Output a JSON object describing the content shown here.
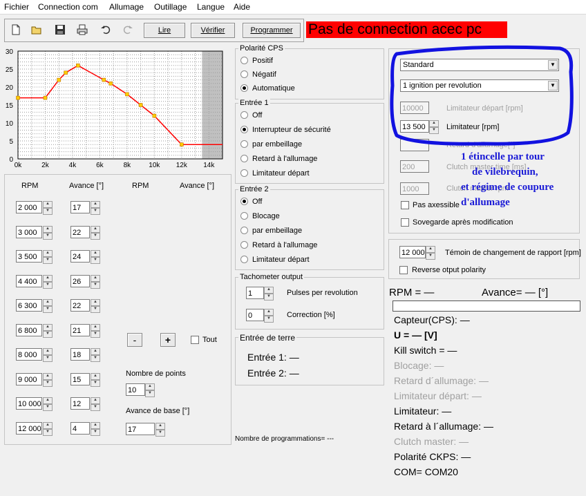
{
  "menu": [
    "Fichier",
    "Connection com",
    "Allumage",
    "Outillage",
    "Langue",
    "Aide"
  ],
  "toolbar": {
    "read": "Lire",
    "verify": "Vérifier",
    "program": "Programmer"
  },
  "status": "Pas de connection acec pc",
  "chart_data": {
    "type": "line",
    "x": [
      0,
      2000,
      3000,
      3500,
      4400,
      6300,
      6800,
      8000,
      9000,
      10000,
      12000,
      15000
    ],
    "y": [
      17,
      17,
      22,
      24,
      26,
      22,
      21,
      18,
      15,
      12,
      4,
      4
    ],
    "xlim": [
      0,
      15000
    ],
    "ylim": [
      0,
      30
    ],
    "xticks": [
      "0k",
      "2k",
      "4k",
      "6k",
      "8k",
      "10k",
      "12k",
      "14k"
    ],
    "yticks": [
      "0",
      "5",
      "10",
      "15",
      "20",
      "25",
      "30"
    ],
    "grid": true,
    "colors": {
      "line": "#ff0000",
      "marker": "#ffcc00",
      "limit_zone": "#c0c0c0"
    }
  },
  "table": {
    "headers": [
      "RPM",
      "Avance [°]",
      "RPM",
      "Avance [°]"
    ],
    "rows": [
      {
        "rpm": "2 000",
        "adv": "17"
      },
      {
        "rpm": "3 000",
        "adv": "22"
      },
      {
        "rpm": "3 500",
        "adv": "24"
      },
      {
        "rpm": "4 400",
        "adv": "26"
      },
      {
        "rpm": "6 300",
        "adv": "22"
      },
      {
        "rpm": "6 800",
        "adv": "21"
      },
      {
        "rpm": "8 000",
        "adv": "18"
      },
      {
        "rpm": "9 000",
        "adv": "15"
      },
      {
        "rpm": "10 000",
        "adv": "12"
      },
      {
        "rpm": "12 000",
        "adv": "4"
      }
    ]
  },
  "points": {
    "minus": "-",
    "plus": "+",
    "all": "Tout",
    "count_label": "Nombre de points",
    "count": "10",
    "base_label": "Avance de base [°]",
    "base": "17"
  },
  "polarity": {
    "title": "Polarité CPS",
    "options": [
      "Positif",
      "Négatif",
      "Automatique"
    ]
  },
  "input1": {
    "title": "Entrée 1",
    "options": [
      "Off",
      "Interrupteur de sécurité",
      "par embeillage",
      "Retard à l'allumage",
      "Limitateur départ"
    ]
  },
  "input2": {
    "title": "Entrée 2",
    "options": [
      "Off",
      "Blocage",
      "par embeillage",
      "Retard à l'allumage",
      "Limitateur départ"
    ]
  },
  "tacho": {
    "title": "Tachometer output",
    "pulses": "1",
    "pulses_label": "Pulses per revolution",
    "correction": "0",
    "correction_label": "Correction [%]"
  },
  "ground": {
    "title": "Entrée de terre",
    "in1": "Entrée 1: —",
    "in2": "Entrée 2: —"
  },
  "prog_count": "Nombre de programmations= ---",
  "config": {
    "mode": "Standard",
    "ignition": "1 ignition per revolution",
    "start_limit": "10000",
    "start_limit_label": "Limitateur départ [rpm]",
    "limiter": "13 500",
    "limiter_label": "Limitateur [rpm]",
    "retard_label": "Retard d'allumage[°]",
    "clutch_time": "200",
    "clutch_time_label": "Clutch master time [ms]",
    "clutch_rpm": "1000",
    "clutch_rpm_label": "Clutch master rpm",
    "no_axes": "Pas axessible",
    "save": "Sovegarde après modification"
  },
  "shift": {
    "value": "12 000",
    "label": "Témoin de changement de rapport [rpm]",
    "reverse": "Reverse otput polarity"
  },
  "live": {
    "rpm": "RPM = —",
    "advance": "Avance= — [°]",
    "cps": "Capteur(CPS): —",
    "voltage": "U = — [V]",
    "kill": "Kill switch = —",
    "blocage": "Blocage: —",
    "retard": "Retard d´allumage: —",
    "limit_start": "Limitateur départ: —",
    "limiter": "Limitateur: —",
    "retard2": "Retard à l´allumage: —",
    "clutch": "Clutch master: —",
    "ckps": "Polarité CKPS: —",
    "com": "COM= COM20"
  },
  "annotation": [
    "1 étincelle par tour",
    "de vilebrequin,",
    "et régime de coupure",
    "d'allumage"
  ]
}
